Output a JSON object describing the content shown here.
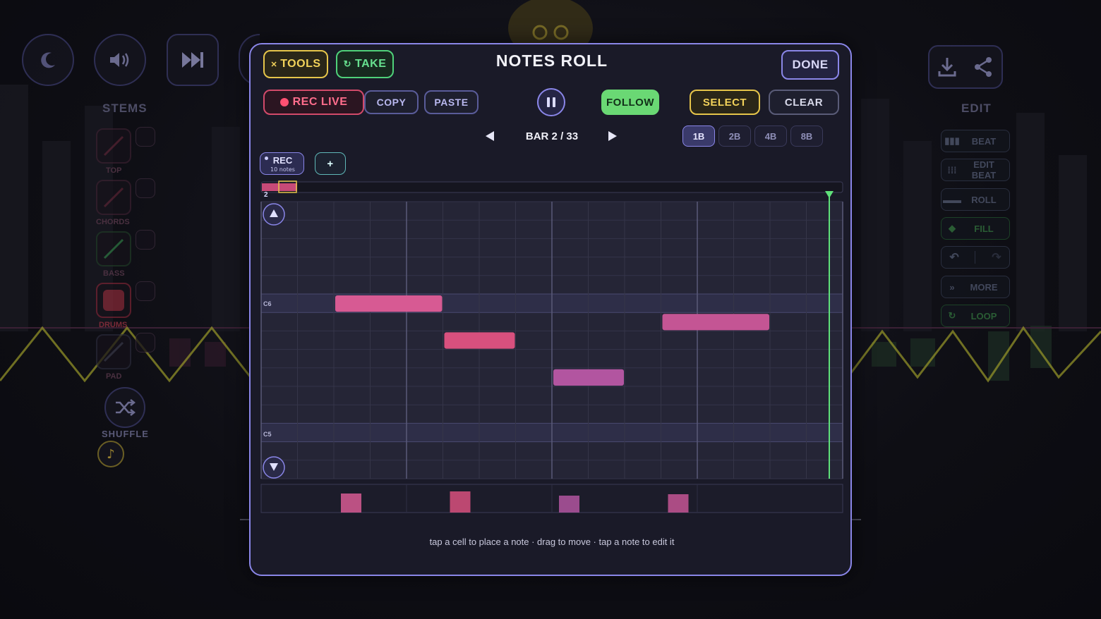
{
  "left_toolbar": {
    "moon_icon": "moon-icon",
    "volume_icon": "volume-icon",
    "skip_icon": "skip-forward-icon"
  },
  "stems": {
    "title": "STEMS",
    "items": [
      {
        "label": "TOP",
        "color": "#d23a5a"
      },
      {
        "label": "CHORDS",
        "color": "#d23a5a"
      },
      {
        "label": "BASS",
        "color": "#3fa85a"
      },
      {
        "label": "DRUMS",
        "color": "#ff5a6a"
      },
      {
        "label": "PAD",
        "color": "#6a6a8a"
      }
    ],
    "shuffle_label": "SHUFFLE"
  },
  "edit_panel": {
    "title": "EDIT",
    "items": [
      {
        "label": "BEAT",
        "icon": "beat-bars-icon"
      },
      {
        "label": "EDIT BEAT",
        "icon": "dots-grid-icon"
      },
      {
        "label": "ROLL",
        "icon": "roll-icon"
      },
      {
        "label": "FILL",
        "icon": "fill-icon"
      },
      {
        "label": "",
        "icon": "undo-redo-icon"
      },
      {
        "label": "MORE",
        "icon": "chevrons-right-icon"
      },
      {
        "label": "LOOP",
        "icon": "loop-icon"
      }
    ]
  },
  "modal": {
    "title": "NOTES ROLL",
    "tools_label": "TOOLS",
    "take_label": "TAKE",
    "done_label": "DONE",
    "rec_live_label": "REC LIVE",
    "copy_label": "COPY",
    "paste_label": "PASTE",
    "follow_label": "FOLLOW",
    "select_label": "SELECT",
    "clear_label": "CLEAR",
    "bar_label": "BAR 2 / 33",
    "resolutions": [
      "1B",
      "2B",
      "4B",
      "8B"
    ],
    "active_resolution": "1B",
    "rec_badge": {
      "label": "REC",
      "sub": "10 notes"
    },
    "add_label": "+",
    "overview_bar_number": "2",
    "pitch_labels": {
      "top": "C6",
      "bottom": "C5"
    },
    "hint": "tap a cell to place a note · drag to move · tap a note to edit it"
  },
  "notes": [
    {
      "pitch": "C6",
      "row": 5,
      "start_step": 2,
      "length_steps": 3,
      "velocity": 0.72,
      "color": "#d75a93"
    },
    {
      "pitch": "A#5",
      "row": 7,
      "start_step": 5,
      "length_steps": 2,
      "velocity": 0.8,
      "color": "#d8507e"
    },
    {
      "pitch": "G5",
      "row": 9,
      "start_step": 8,
      "length_steps": 2,
      "velocity": 0.62,
      "color": "#b255a0"
    },
    {
      "pitch": "B5",
      "row": 6,
      "start_step": 11,
      "length_steps": 3,
      "velocity": 0.68,
      "color": "#c45594"
    }
  ],
  "colors": {
    "accent": "#8a86e8",
    "playhead": "#5fe07a",
    "note_pink": "#d75a93"
  }
}
